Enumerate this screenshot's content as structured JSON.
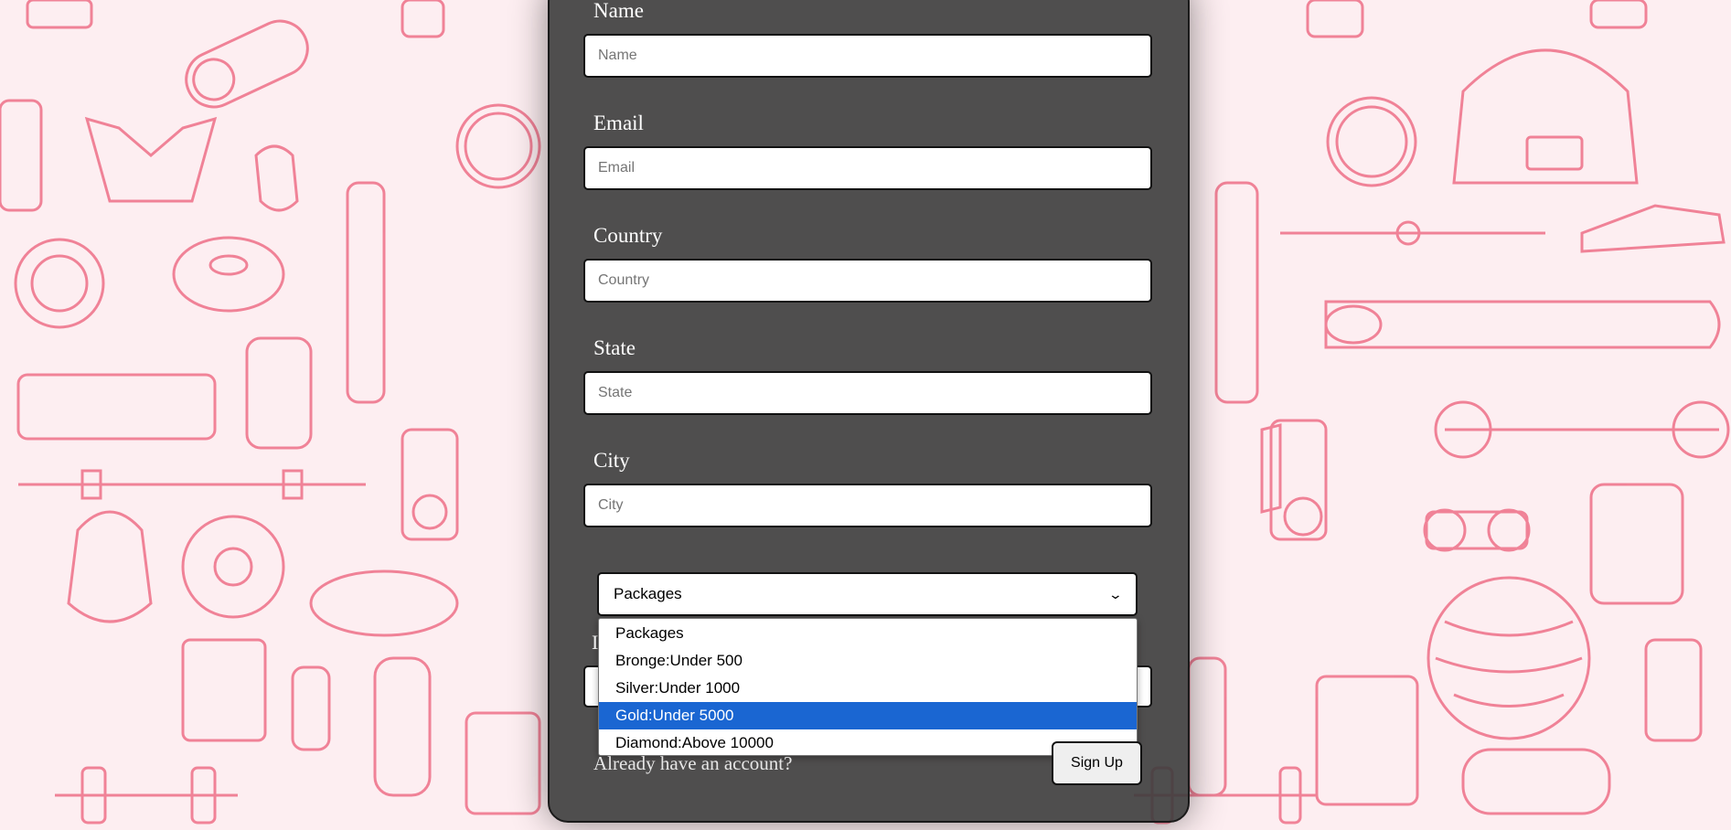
{
  "colors": {
    "page_background": "#fdeef1",
    "pattern_stroke": "#ee7088",
    "panel": "#3c3c3c",
    "highlight": "#1a66d2"
  },
  "form": {
    "fields": [
      {
        "label": "Name",
        "placeholder": "Name"
      },
      {
        "label": "Email",
        "placeholder": "Email"
      },
      {
        "label": "Country",
        "placeholder": "Country"
      },
      {
        "label": "State",
        "placeholder": "State"
      },
      {
        "label": "City",
        "placeholder": "City"
      }
    ],
    "packages_select": {
      "selected": "Packages",
      "options": [
        "Packages",
        "Bronge:Under 500",
        "Silver:Under 1000",
        "Gold:Under 5000",
        "Diamond:Above 10000"
      ],
      "highlighted_option": "Gold:Under 5000"
    },
    "already_text": "Already have an account?",
    "signup_label": "Sign Up"
  }
}
